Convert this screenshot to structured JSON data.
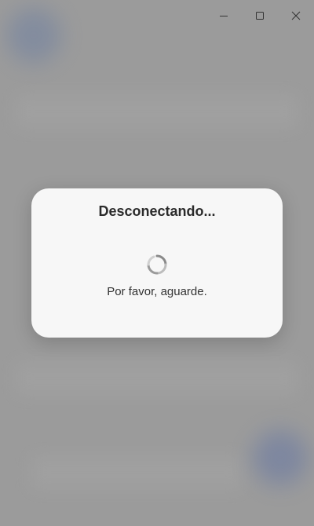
{
  "window": {
    "controls": {
      "minimize_icon": "minimize-icon",
      "maximize_icon": "maximize-icon",
      "close_icon": "close-icon"
    },
    "background_color": "#9b9b9b"
  },
  "dialog": {
    "title": "Desconectando...",
    "message": "Por favor, aguarde.",
    "spinner_icon": "loading-spinner-icon",
    "background_color": "#f7f7f7"
  }
}
